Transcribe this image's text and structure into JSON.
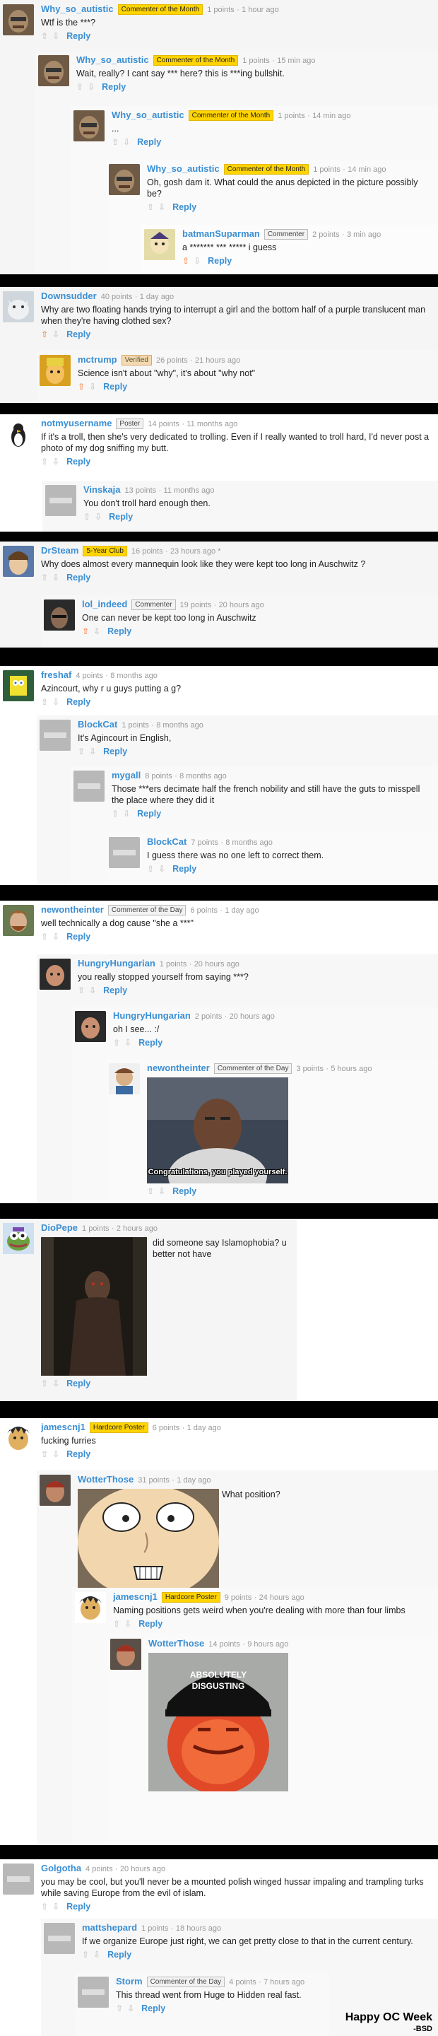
{
  "watermark": {
    "title": "Happy OC Week",
    "signature": "-BSD"
  },
  "common": {
    "reply": "Reply",
    "up": "⇧",
    "down": "⇩"
  },
  "threads": [
    {
      "comments": [
        {
          "user": "Why_so_autistic",
          "badge": "Commenter of the Month",
          "points": "1 points",
          "time": "1 hour ago",
          "text": "Wtf is the ***?"
        },
        {
          "user": "Why_so_autistic",
          "badge": "Commenter of the Month",
          "points": "1 points",
          "time": "15 min ago",
          "text": "Wait, really? I cant say *** here? this is ***ing bullshit."
        },
        {
          "user": "Why_so_autistic",
          "badge": "Commenter of the Month",
          "points": "1 points",
          "time": "14 min ago",
          "text": "..."
        },
        {
          "user": "Why_so_autistic",
          "badge": "Commenter of the Month",
          "points": "1 points",
          "time": "14 min ago",
          "text": "Oh, gosh dam it. What could the anus depicted in the picture possibly be?"
        },
        {
          "user": "batmanSuparman",
          "badge": "Commenter",
          "points": "2 points",
          "time": "3 min ago",
          "text": "a ******* *** ***** i guess"
        }
      ]
    },
    {
      "comments": [
        {
          "user": "Downsudder",
          "points": "40 points",
          "time": "1 day ago",
          "text": "Why are two floating hands trying to interrupt a girl and the bottom half of a purple translucent man when they're having clothed sex?"
        },
        {
          "user": "mctrump",
          "badge": "Verified",
          "points": "26 points",
          "time": "21 hours ago",
          "text": "Science isn't about \"why\", it's about \"why not\""
        }
      ]
    },
    {
      "comments": [
        {
          "user": "notmyusername",
          "badge": "Poster",
          "points": "14 points",
          "time": "11 months ago",
          "text": "If it's a troll, then she's very dedicated to trolling. Even if I really wanted to troll hard, I'd never post a photo of my dog sniffing my butt."
        },
        {
          "user": "Vinskaja",
          "points": "13 points",
          "time": "11 months ago",
          "text": "You don't troll hard enough then."
        }
      ]
    },
    {
      "comments": [
        {
          "user": "DrSteam",
          "badge": "5-Year Club",
          "points": "16 points",
          "time": "23 hours ago *",
          "text": "Why does almost every mannequin look like they were kept too long in Auschwitz ?"
        },
        {
          "user": "lol_indeed",
          "badge": "Commenter",
          "points": "19 points",
          "time": "20 hours ago",
          "text": "One can never be kept too long in Auschwitz"
        }
      ]
    },
    {
      "comments": [
        {
          "user": "freshaf",
          "points": "4 points",
          "time": "8 months ago",
          "text": "Azincourt, why r u guys putting a g?"
        },
        {
          "user": "BlockCat",
          "points": "1 points",
          "time": "8 months ago",
          "text": "It's Agincourt in English,"
        },
        {
          "user": "mygall",
          "points": "8 points",
          "time": "8 months ago",
          "text": "Those ***ers decimate half the french nobility and still have the guts to misspell the place where they did it"
        },
        {
          "user": "BlockCat",
          "points": "7 points",
          "time": "8 months ago",
          "text": "I guess there was no one left to correct them."
        }
      ]
    },
    {
      "comments": [
        {
          "user": "newontheinter",
          "badge": "Commenter of the Day",
          "points": "6 points",
          "time": "1 day ago",
          "text": "well technically a dog cause \"she a ***\""
        },
        {
          "user": "HungryHungarian",
          "points": "1 points",
          "time": "20 hours ago",
          "text": "you really stopped yourself from saying ***?"
        },
        {
          "user": "HungryHungarian",
          "points": "2 points",
          "time": "20 hours ago",
          "text": "oh I see...  :/"
        },
        {
          "user": "newontheinter",
          "badge": "Commenter of the Day",
          "points": "3 points",
          "time": "5 hours ago",
          "text": "",
          "caption": "Congratulations, you played yourself."
        }
      ]
    },
    {
      "comments": [
        {
          "user": "DioPepe",
          "points": "1 points",
          "time": "2 hours ago",
          "text": "did someone say Islamophobia? u better not have"
        }
      ]
    },
    {
      "comments": [
        {
          "user": "jamescnj1",
          "badge": "Hardcore Poster",
          "points": "6 points",
          "time": "1 day ago",
          "text": "fucking furries"
        },
        {
          "user": "WotterThose",
          "points": "31 points",
          "time": "1 day ago",
          "text": "What position?"
        },
        {
          "user": "jamescnj1",
          "badge": "Hardcore Poster",
          "points": "9 points",
          "time": "24 hours ago",
          "text": "Naming positions gets weird when you're dealing with more than four limbs"
        },
        {
          "user": "WotterThose",
          "points": "14 points",
          "time": "9 hours ago",
          "text": "",
          "hat1": "ABSOLUTELY",
          "hat2": "DISGUSTING"
        }
      ]
    },
    {
      "comments": [
        {
          "user": "Golgotha",
          "points": "4 points",
          "time": "20 hours ago",
          "text": "you may be cool, but you'll never be a mounted polish winged hussar impaling and trampling turks while saving Europe from the evil of islam."
        },
        {
          "user": "mattshepard",
          "points": "1 points",
          "time": "18 hours ago",
          "text": "If we organize Europe just right, we can get pretty close to that in the current century."
        },
        {
          "user": "Storm",
          "badge": "Commenter of the Day",
          "points": "4 points",
          "time": "7 hours ago",
          "text": "This thread went from Huge to Hidden real fast."
        }
      ]
    }
  ]
}
